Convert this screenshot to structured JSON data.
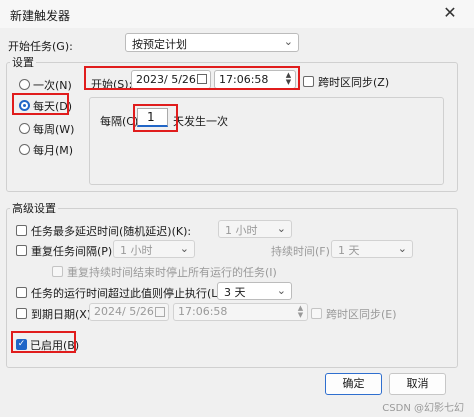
{
  "window": {
    "title": "新建触发器",
    "close_glyph": "✕"
  },
  "start_task": {
    "label": "开始任务(G):",
    "value": "按预定计划"
  },
  "settings": {
    "label": "设置",
    "radios": [
      {
        "label": "一次(N)",
        "selected": false
      },
      {
        "label": "每天(D)",
        "selected": true
      },
      {
        "label": "每周(W)",
        "selected": false
      },
      {
        "label": "每月(M)",
        "selected": false
      }
    ],
    "start_label": "开始(S):",
    "start_date": "2023/ 5/26",
    "start_time": "17:06:58",
    "sync_timezone_label": "跨时区同步(Z)",
    "interval_prefix": "每隔(C):",
    "interval_value": "1",
    "interval_suffix": "天发生一次"
  },
  "advanced": {
    "label": "高级设置",
    "delay": {
      "label": "任务最多延迟时间(随机延迟)(K):",
      "value": "1 小时"
    },
    "repeat": {
      "label": "重复任务间隔(P):",
      "value": "1 小时",
      "duration_label": "持续时间(F):",
      "duration_value": "1 天",
      "stop_label": "重复持续时间结束时停止所有运行的任务(I)"
    },
    "stop_after": {
      "label": "任务的运行时间超过此值则停止执行(L):",
      "value": "3 天"
    },
    "expire": {
      "label": "到期日期(X):",
      "date": "2024/ 5/26",
      "time": "17:06:58",
      "sync_label": "跨时区同步(E)"
    },
    "enabled": {
      "label": "已启用(B)",
      "checked": true
    }
  },
  "buttons": {
    "ok": "确定",
    "cancel": "取消"
  },
  "watermark": "CSDN @幻影七幻",
  "colors": {
    "accent": "#2166c7",
    "highlight": "#e01c1c"
  }
}
